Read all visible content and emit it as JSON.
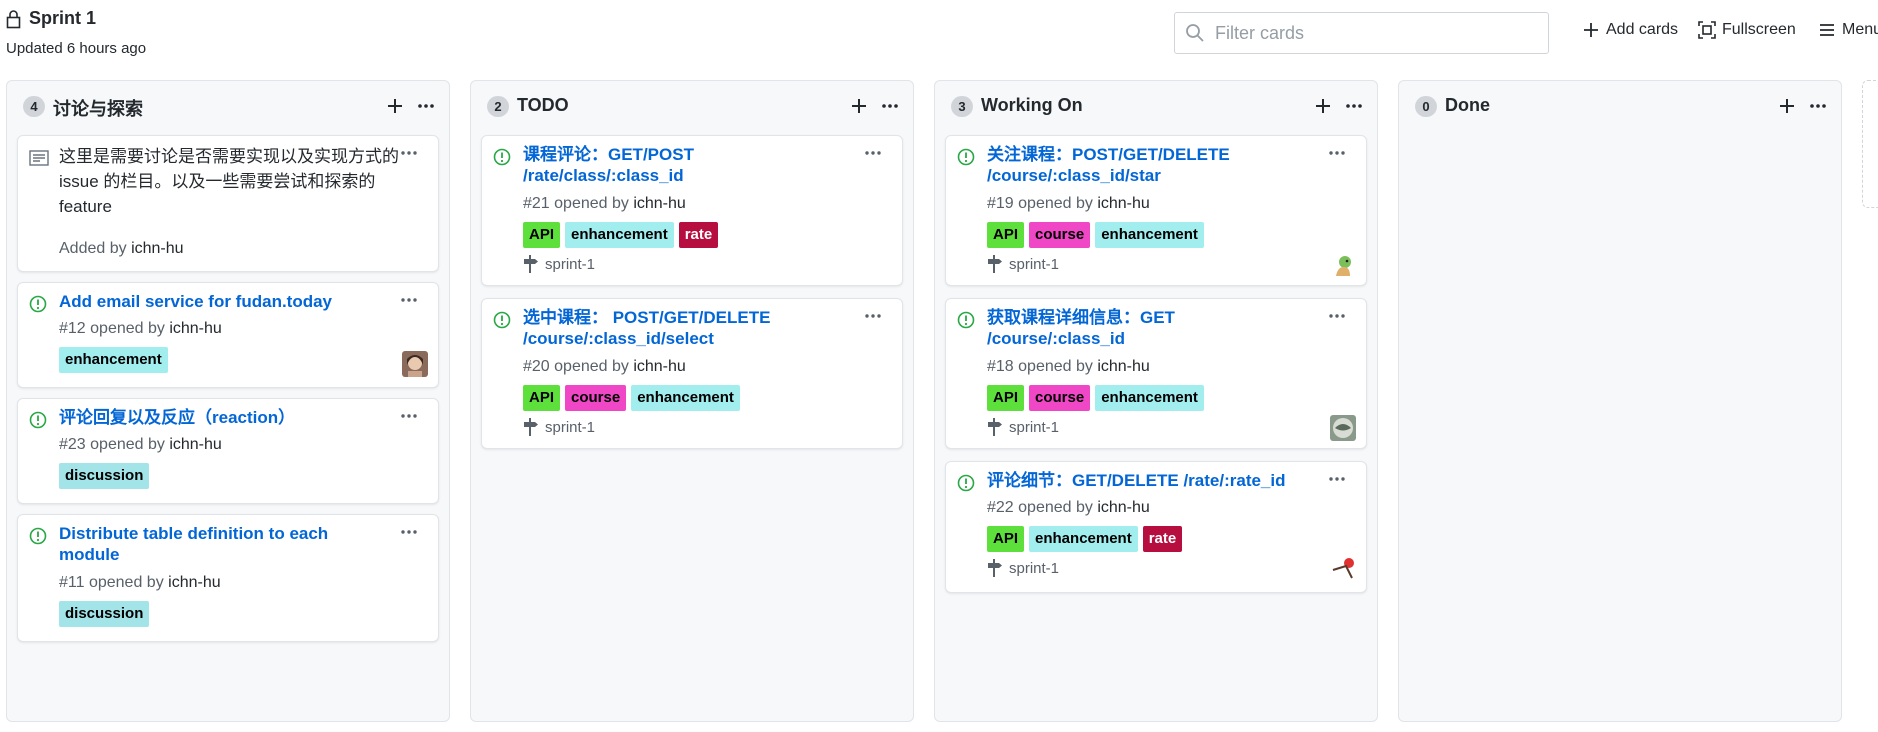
{
  "header": {
    "title": "Sprint 1",
    "updated": "Updated 6 hours ago",
    "search_placeholder": "Filter cards",
    "add_cards": "Add cards",
    "fullscreen": "Fullscreen",
    "menu": "Menu"
  },
  "colors": {
    "link": "#0366d6",
    "open_issue": "#28a745",
    "label_api": "#5ee03c",
    "label_enhancement": "#a2eeef",
    "label_rate": "#b60f3f",
    "label_course": "#ef47c5",
    "label_discussion": "#a2e4e8"
  },
  "columns": [
    {
      "count": "4",
      "name": "讨论与探索",
      "note": {
        "text": "这里是需要讨论是否需要实现以及实现方式的 issue 的栏目。以及一些需要尝试和探索的 feature",
        "added_prefix": "Added by",
        "author": "ichn-hu"
      },
      "cards": [
        {
          "title": "Add email service for fudan.today",
          "number": "#12 opened by",
          "author": "ichn-hu",
          "labels": [
            "enhancement"
          ]
        },
        {
          "title": "评论回复以及反应（reaction）",
          "number": "#23 opened by",
          "author": "ichn-hu",
          "labels": [
            "discussion"
          ]
        },
        {
          "title": "Distribute table definition to each module",
          "number": "#11 opened by",
          "author": "ichn-hu",
          "labels": [
            "discussion"
          ]
        }
      ]
    },
    {
      "count": "2",
      "name": "TODO",
      "cards": [
        {
          "title": "课程评论：GET/POST /rate/class/:class_id",
          "number": "#21 opened by",
          "author": "ichn-hu",
          "labels": [
            "API",
            "enhancement",
            "rate"
          ],
          "milestone": "sprint-1"
        },
        {
          "title": "选中课程： POST/GET/DELETE /course/:class_id/select",
          "number": "#20 opened by",
          "author": "ichn-hu",
          "labels": [
            "API",
            "course",
            "enhancement"
          ],
          "milestone": "sprint-1"
        }
      ]
    },
    {
      "count": "3",
      "name": "Working On",
      "cards": [
        {
          "title": "关注课程：POST/GET/DELETE /course/:class_id/star",
          "number": "#19 opened by",
          "author": "ichn-hu",
          "labels": [
            "API",
            "course",
            "enhancement"
          ],
          "milestone": "sprint-1"
        },
        {
          "title": "获取课程详细信息：GET /course/:class_id",
          "number": "#18 opened by",
          "author": "ichn-hu",
          "labels": [
            "API",
            "course",
            "enhancement"
          ],
          "milestone": "sprint-1"
        },
        {
          "title": "评论细节：GET/DELETE /rate/:rate_id",
          "number": "#22 opened by",
          "author": "ichn-hu",
          "labels": [
            "API",
            "enhancement",
            "rate"
          ],
          "milestone": "sprint-1"
        }
      ]
    },
    {
      "count": "0",
      "name": "Done",
      "cards": []
    }
  ]
}
